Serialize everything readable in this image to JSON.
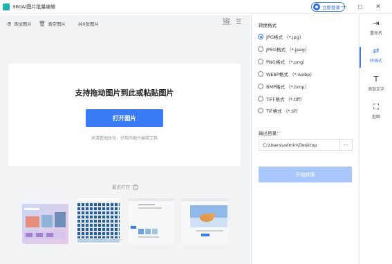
{
  "titlebar": {
    "app_title": "360AI图片批量编辑",
    "login_label": "立即登录",
    "minimize": "—",
    "maximize": "☐",
    "close": "✕"
  },
  "toolbar": {
    "add_label": "添加图片",
    "clear_label": "清空图片",
    "count_label": "共0张图片",
    "add_icon": "⊕",
    "clear_icon": "🗑",
    "image_icon": "🖼",
    "list_icon": "☰"
  },
  "dropzone": {
    "title": "支持拖动图片到此或粘贴图片",
    "open_label": "打开图片",
    "subtitle": "高清看图体验，好用的图片编辑工具"
  },
  "recent": {
    "label": "最近打开",
    "help": "?"
  },
  "convert": {
    "title": "转换格式",
    "options": [
      {
        "label": "JPG格式 （*.jpg）",
        "selected": true
      },
      {
        "label": "JPEG格式 （*.jpeg）",
        "selected": false
      },
      {
        "label": "PNG格式 （*.png）",
        "selected": false
      },
      {
        "label": "WEBP格式 （*.webp）",
        "selected": false
      },
      {
        "label": "BMP格式 （*.bmp）",
        "selected": false
      },
      {
        "label": "TIFF格式 （*.tiff）",
        "selected": false
      },
      {
        "label": "TIF格式 （*.tif）",
        "selected": false
      }
    ],
    "output_label": "输出目录：",
    "output_value": "C:\\Users\\admin\\Desktop",
    "browse_label": "···",
    "start_label": "开始转换"
  },
  "sidebar": {
    "items": [
      {
        "label": "重命名",
        "icon": "⇥"
      },
      {
        "label": "转格式",
        "icon": "⇄"
      },
      {
        "label": "添加文字",
        "icon": "T"
      },
      {
        "label": "抠图",
        "icon": "⛶"
      }
    ]
  },
  "colors": {
    "accent": "#3b7cf6",
    "accent_disabled": "#a9c7fb",
    "panel_bg": "#f2f3f5"
  }
}
